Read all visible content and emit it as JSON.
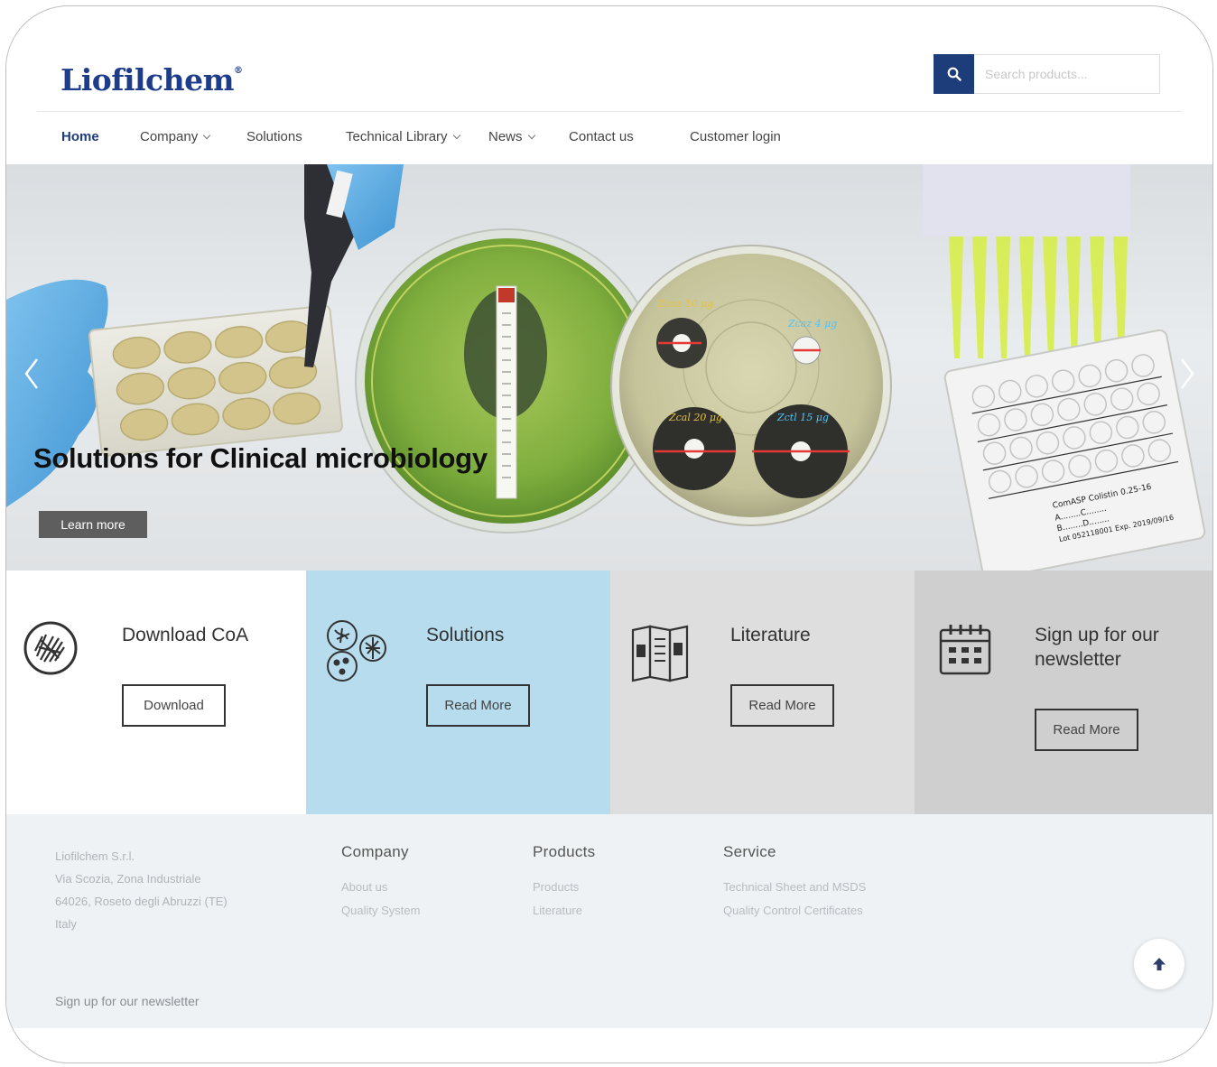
{
  "header": {
    "logo": "Liofilchem",
    "logo_mark": "®",
    "search": {
      "placeholder": "Search products..."
    }
  },
  "nav": {
    "items": [
      {
        "label": "Home",
        "active": true
      },
      {
        "label": "Company",
        "dropdown": true
      },
      {
        "label": "Solutions"
      },
      {
        "label": "Technical Library",
        "dropdown": true
      },
      {
        "label": "News",
        "dropdown": true
      },
      {
        "label": "Contact us"
      },
      {
        "label": "Customer login"
      }
    ]
  },
  "hero": {
    "title": "Solutions for Clinical microbiology",
    "button": "Learn more",
    "plate_labels": [
      "Zcaz 10 μg",
      "Zcaz 4 μg",
      "Zcal 20 μg",
      "Zctl 15 μg"
    ],
    "panel_label": "ComASP Colistin 0.25-16",
    "panel_fields": "A........C........",
    "panel_fields2": "B........D........",
    "panel_lot": "Lot 052118001 Exp. 2019/09/16"
  },
  "cards": [
    {
      "title": "Download CoA",
      "button": "Download",
      "icon": "bacteria-colony-icon",
      "color": "#ffffff"
    },
    {
      "title": "Solutions",
      "button": "Read More",
      "icon": "microbes-icon",
      "color": "#b6dced"
    },
    {
      "title": "Literature",
      "button": "Read More",
      "icon": "brochure-icon",
      "color": "#dedede"
    },
    {
      "title": "Sign up for our newsletter",
      "button": "Read More",
      "icon": "calendar-icon",
      "color": "#cfcfcf"
    }
  ],
  "footer": {
    "address": [
      "Liofilchem S.r.l.",
      "Via Scozia, Zona Industriale",
      "64026, Roseto degli Abruzzi (TE)",
      "Italy"
    ],
    "columns": [
      {
        "title": "Company",
        "links": [
          "About us",
          "Quality System"
        ]
      },
      {
        "title": "Products",
        "links": [
          "Products",
          "Literature"
        ]
      },
      {
        "title": "Service",
        "links": [
          "Technical Sheet and MSDS",
          "Quality Control Certificates"
        ]
      }
    ],
    "newsletter": "Sign up for our newsletter"
  },
  "colors": {
    "brand": "#1d3c8c",
    "search_button": "#1c3d7a",
    "solutions_card": "#b6dced"
  }
}
